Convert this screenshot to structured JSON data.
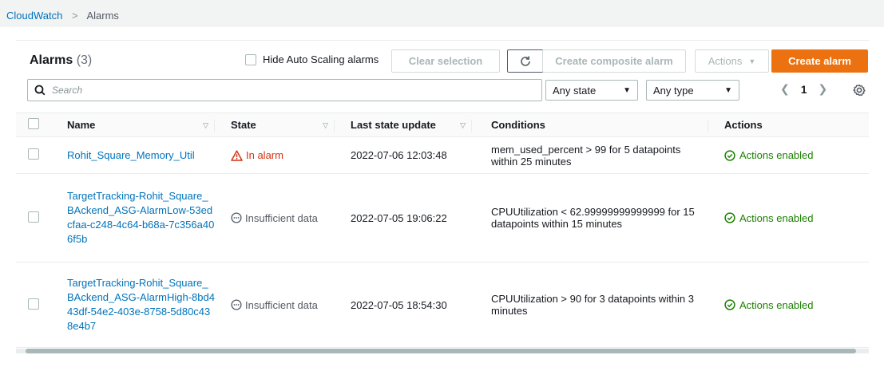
{
  "breadcrumb": {
    "root": "CloudWatch",
    "current": "Alarms"
  },
  "header": {
    "title": "Alarms",
    "count": "(3)"
  },
  "toolbar": {
    "hide_autoscaling_label": "Hide Auto Scaling alarms",
    "clear_selection": "Clear selection",
    "create_composite": "Create composite alarm",
    "actions": "Actions",
    "create_alarm": "Create alarm"
  },
  "search": {
    "placeholder": "Search"
  },
  "filters": {
    "state": "Any state",
    "type": "Any type"
  },
  "pagination": {
    "page": "1"
  },
  "table": {
    "columns": [
      "Name",
      "State",
      "Last state update",
      "Conditions",
      "Actions"
    ],
    "rows": [
      {
        "name": "Rohit_Square_Memory_Util",
        "state": "In alarm",
        "last_update": "2022-07-06 12:03:48",
        "conditions": "mem_used_percent > 99 for 5 datapoints within 25 minutes",
        "actions": "Actions enabled"
      },
      {
        "name": "TargetTracking-Rohit_Square_BAckend_ASG-AlarmLow-53edcfaa-c248-4c64-b68a-7c356a406f5b",
        "state": "Insufficient data",
        "last_update": "2022-07-05 19:06:22",
        "conditions": "CPUUtilization < 62.99999999999999 for 15 datapoints within 15 minutes",
        "actions": "Actions enabled"
      },
      {
        "name": "TargetTracking-Rohit_Square_BAckend_ASG-AlarmHigh-8bd443df-54e2-403e-8758-5d80c438e4b7",
        "state": "Insufficient data",
        "last_update": "2022-07-05 18:54:30",
        "conditions": "CPUUtilization > 90 for 3 datapoints within 3 minutes",
        "actions": "Actions enabled"
      }
    ]
  },
  "colors": {
    "link": "#0073bb",
    "alarm": "#d13212",
    "enabled": "#1d8102",
    "primary": "#ec7211"
  }
}
